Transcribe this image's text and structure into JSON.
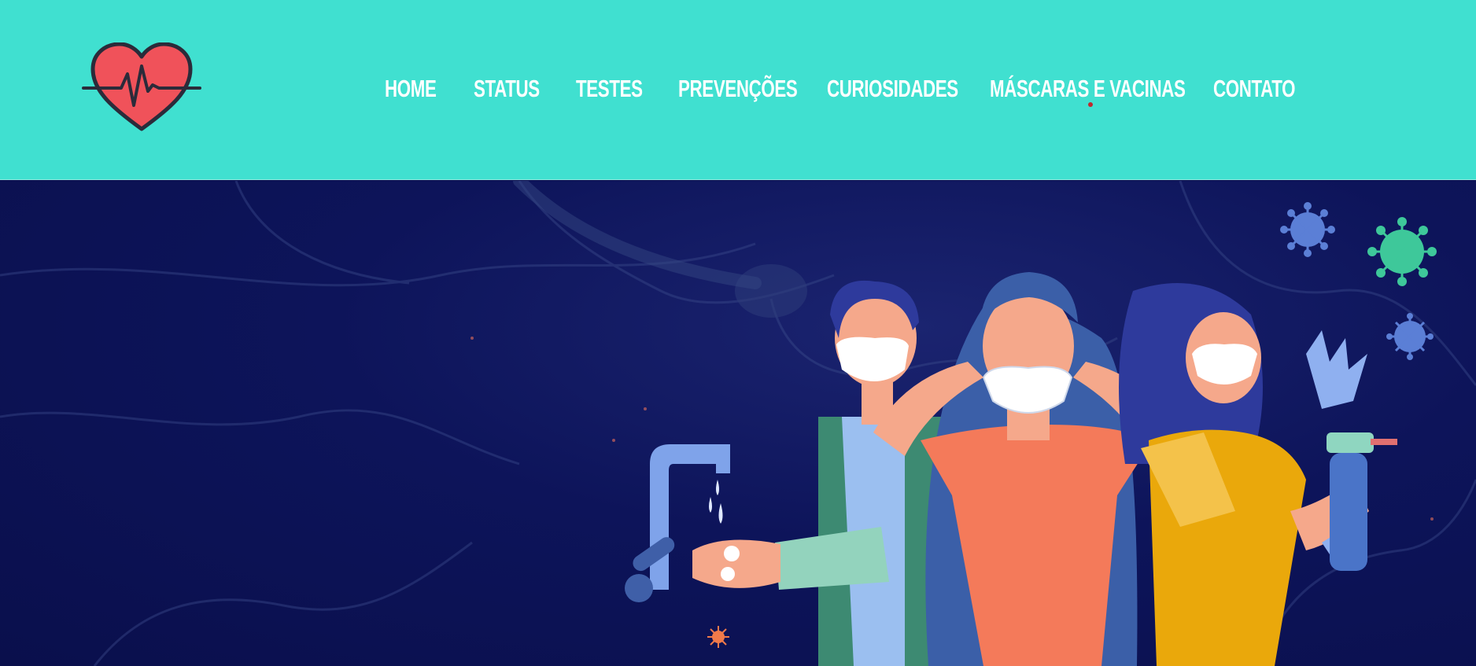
{
  "site": {
    "logo_icon": "heart-pulse-icon"
  },
  "nav": {
    "items": [
      {
        "label": "HOME"
      },
      {
        "label": "STATUS"
      },
      {
        "label": "TESTES"
      },
      {
        "label": "PREVENÇÕES"
      },
      {
        "label": "CURIOSIDADES"
      },
      {
        "label": "MÁSCARAS E VACINAS"
      },
      {
        "label": "CONTATO"
      }
    ],
    "active_index": 5
  },
  "colors": {
    "header_bg": "#40e0d0",
    "hero_bg": "#0d145a",
    "nav_text": "#ffffff",
    "heart": "#f0525a",
    "active_indicator": "#c0292e"
  },
  "hero": {
    "illustration": "people-wearing-masks-illustration"
  }
}
